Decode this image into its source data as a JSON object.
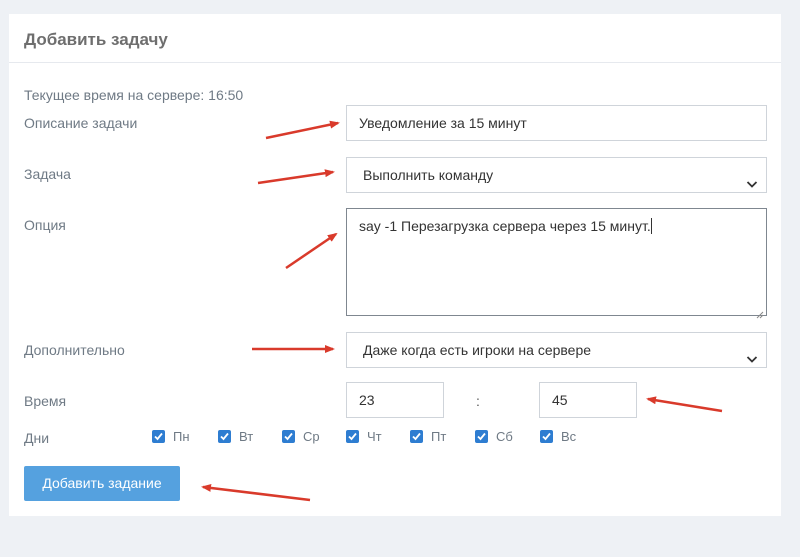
{
  "header": {
    "title": "Добавить задачу"
  },
  "form": {
    "server_time": "Текущее время на сервере: 16:50",
    "description": {
      "label": "Описание задачи",
      "value": "Уведомление за 15 минут"
    },
    "task": {
      "label": "Задача",
      "value": "Выполнить команду"
    },
    "option": {
      "label": "Опция",
      "value": "say -1 Перезагрузка сервера через 15 минут."
    },
    "additional": {
      "label": "Дополнительно",
      "value": "Даже когда есть игроки на сервере"
    },
    "time": {
      "label": "Время",
      "hours": "23",
      "separator": ":",
      "minutes": "45"
    },
    "days": {
      "label": "Дни",
      "items": [
        {
          "label": "Пн",
          "checked": true
        },
        {
          "label": "Вт",
          "checked": true
        },
        {
          "label": "Ср",
          "checked": true
        },
        {
          "label": "Чт",
          "checked": true
        },
        {
          "label": "Пт",
          "checked": true
        },
        {
          "label": "Сб",
          "checked": true
        },
        {
          "label": "Вс",
          "checked": true
        }
      ]
    },
    "submit_label": "Добавить задание"
  },
  "colors": {
    "accent": "#55a1df",
    "checkbox": "#2e7dd1",
    "annotation_arrow": "#d93a2b"
  },
  "icons": {
    "select_chevron": "chevron-down-icon",
    "checkbox_mark": "check-icon",
    "annotation": "arrow-icon"
  }
}
